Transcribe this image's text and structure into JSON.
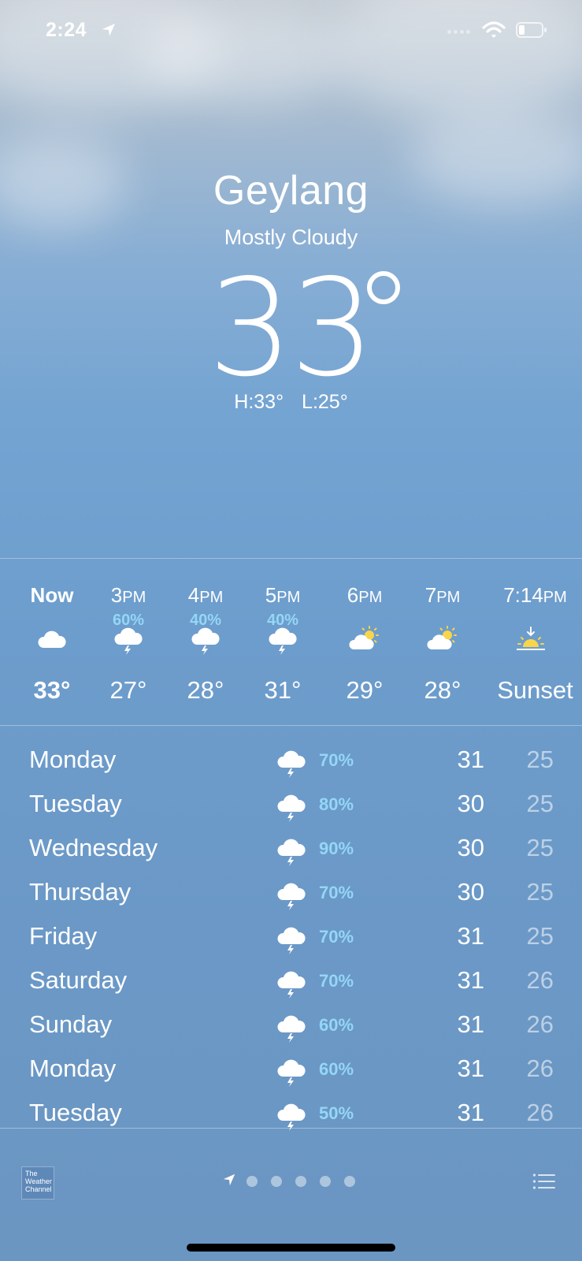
{
  "status_bar": {
    "time": "2:24",
    "icons": [
      "location-arrow-icon",
      "signal-icon",
      "wifi-icon",
      "battery-icon"
    ]
  },
  "current": {
    "city": "Geylang",
    "condition": "Mostly Cloudy",
    "temperature": "33",
    "high": "H:33°",
    "low": "L:25°"
  },
  "hourly": [
    {
      "time": "Now",
      "ampm": "",
      "prob": "",
      "icon": "cloud-icon",
      "temp": "33°",
      "bold": true
    },
    {
      "time": "3",
      "ampm": "PM",
      "prob": "60%",
      "icon": "thunderstorm-icon",
      "temp": "27°"
    },
    {
      "time": "4",
      "ampm": "PM",
      "prob": "40%",
      "icon": "thunderstorm-icon",
      "temp": "28°"
    },
    {
      "time": "5",
      "ampm": "PM",
      "prob": "40%",
      "icon": "thunderstorm-icon",
      "temp": "31°"
    },
    {
      "time": "6",
      "ampm": "PM",
      "prob": "",
      "icon": "partly-cloudy-icon",
      "temp": "29°"
    },
    {
      "time": "7",
      "ampm": "PM",
      "prob": "",
      "icon": "partly-cloudy-icon",
      "temp": "28°"
    },
    {
      "time": "7:14",
      "ampm": "PM",
      "prob": "",
      "icon": "sunset-icon",
      "temp": "Sunset"
    }
  ],
  "daily": [
    {
      "day": "Monday",
      "icon": "thunderstorm-icon",
      "prob": "70%",
      "high": "31",
      "low": "25"
    },
    {
      "day": "Tuesday",
      "icon": "thunderstorm-icon",
      "prob": "80%",
      "high": "30",
      "low": "25"
    },
    {
      "day": "Wednesday",
      "icon": "thunderstorm-icon",
      "prob": "90%",
      "high": "30",
      "low": "25"
    },
    {
      "day": "Thursday",
      "icon": "thunderstorm-icon",
      "prob": "70%",
      "high": "30",
      "low": "25"
    },
    {
      "day": "Friday",
      "icon": "thunderstorm-icon",
      "prob": "70%",
      "high": "31",
      "low": "25"
    },
    {
      "day": "Saturday",
      "icon": "thunderstorm-icon",
      "prob": "70%",
      "high": "31",
      "low": "26"
    },
    {
      "day": "Sunday",
      "icon": "thunderstorm-icon",
      "prob": "60%",
      "high": "31",
      "low": "26"
    },
    {
      "day": "Monday",
      "icon": "thunderstorm-icon",
      "prob": "60%",
      "high": "31",
      "low": "26"
    },
    {
      "day": "Tuesday",
      "icon": "thunderstorm-icon",
      "prob": "50%",
      "high": "31",
      "low": "26"
    }
  ],
  "footer": {
    "logo_text": "The Weather Channel",
    "page_count": 5,
    "icons": [
      "location-arrow-icon",
      "list-icon"
    ]
  },
  "colors": {
    "precip_blue": "#94d6f7",
    "sun_yellow": "#f8d54a"
  }
}
